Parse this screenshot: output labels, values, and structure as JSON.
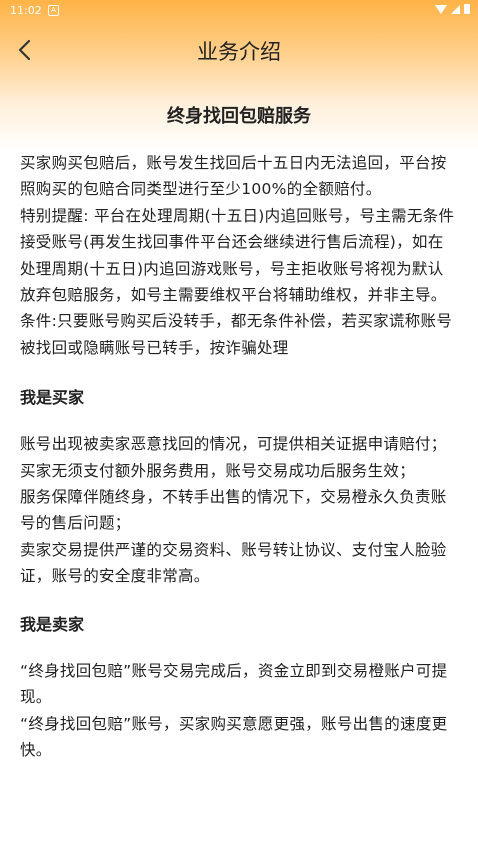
{
  "status_bar": {
    "time": "11:02",
    "app_icon": "A"
  },
  "navbar": {
    "title": "业务介绍",
    "back_icon": "chevron-left-icon"
  },
  "doc": {
    "title": "终身找回包赔服务",
    "intro": [
      "买家购买包赔后，账号发生找回后十五日内无法追回，平台按照购买的包赔合同类型进行至少100%的全额赔付。",
      "特别提醒: 平台在处理周期(十五日)内追回账号，号主需无条件接受账号(再发生找回事件平台还会继续进行售后流程)，如在处理周期(十五日)内追回游戏账号，号主拒收账号将视为默认放弃包赔服务，如号主需要维权平台将辅助维权，并非主导。",
      "条件:只要账号购买后没转手，都无条件补偿，若买家谎称账号被找回或隐瞒账号已转手，按诈骗处理"
    ],
    "buyer_heading": "我是买家",
    "buyer": [
      "账号出现被卖家恶意找回的情况，可提供相关证据申请赔付；",
      "买家无须支付额外服务费用，账号交易成功后服务生效；",
      "服务保障伴随终身，不转手出售的情况下，交易橙永久负责账号的售后问题；",
      "卖家交易提供严谨的交易资料、账号转让协议、支付宝人脸验证，账号的安全度非常高。"
    ],
    "seller_heading": "我是卖家",
    "seller": [
      "“终身找回包赔”账号交易完成后，资金立即到交易橙账户可提现。",
      "“终身找回包赔”账号，买家购买意愿更强，账号出售的速度更快。"
    ]
  }
}
